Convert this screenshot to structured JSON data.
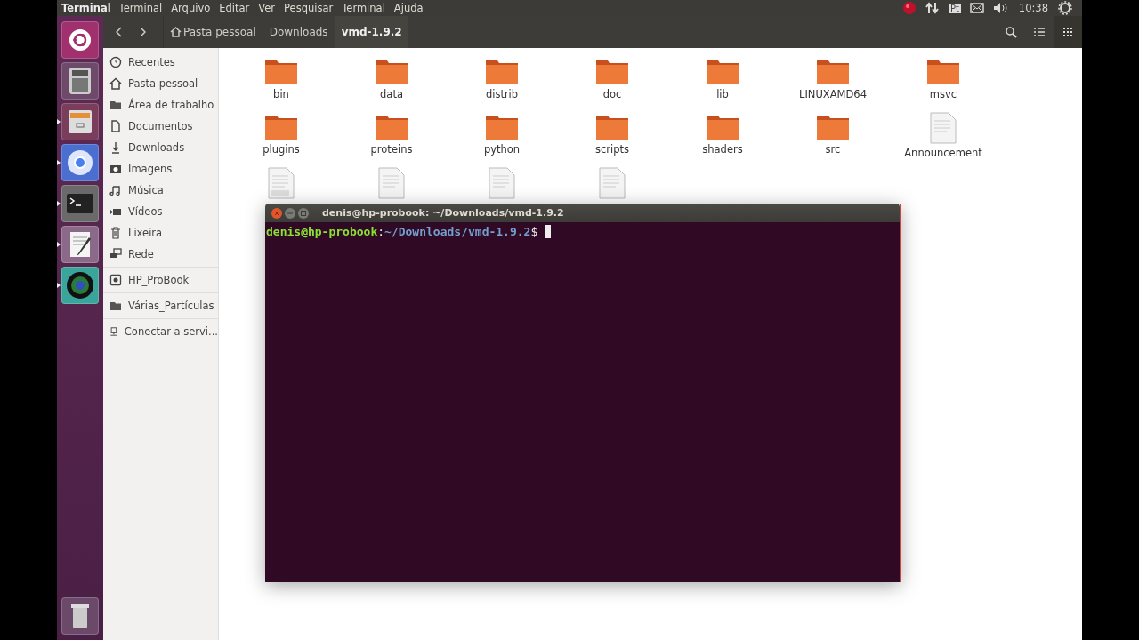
{
  "top_bar": {
    "app_title": "Terminal",
    "menu": [
      "Terminal",
      "Arquivo",
      "Editar",
      "Ver",
      "Pesquisar",
      "Terminal",
      "Ajuda"
    ],
    "keyboard_layout": "Pt",
    "clock": "10:38"
  },
  "launcher": [
    {
      "kind": "ubuntu",
      "running": false
    },
    {
      "kind": "calculator",
      "running": false
    },
    {
      "kind": "files",
      "running": true
    },
    {
      "kind": "browser",
      "running": true
    },
    {
      "kind": "terminal",
      "running": true
    },
    {
      "kind": "editor",
      "running": true
    },
    {
      "kind": "camera",
      "running": true
    },
    {
      "kind": "trash",
      "running": false
    }
  ],
  "breadcrumbs": [
    {
      "label": "Pasta pessoal",
      "home": true,
      "selected": false
    },
    {
      "label": "Downloads",
      "home": false,
      "selected": false
    },
    {
      "label": "vmd-1.9.2",
      "home": false,
      "selected": true
    }
  ],
  "sidebar": {
    "sections": [
      [
        {
          "label": "Recentes",
          "kind": "clock"
        },
        {
          "label": "Pasta pessoal",
          "kind": "home"
        },
        {
          "label": "Área de trabalho",
          "kind": "folder"
        },
        {
          "label": "Documentos",
          "kind": "document"
        },
        {
          "label": "Downloads",
          "kind": "download"
        },
        {
          "label": "Imagens",
          "kind": "camera"
        },
        {
          "label": "Música",
          "kind": "music"
        },
        {
          "label": "Vídeos",
          "kind": "video"
        },
        {
          "label": "Lixeira",
          "kind": "trash"
        },
        {
          "label": "Rede",
          "kind": "network"
        }
      ],
      [
        {
          "label": "HP_ProBook",
          "kind": "drive"
        }
      ],
      [
        {
          "label": "Várias_Partículas",
          "kind": "folder"
        }
      ],
      [
        {
          "label": "Conectar a servi...",
          "kind": "server"
        }
      ]
    ]
  },
  "files": [
    {
      "name": "bin",
      "kind": "folder"
    },
    {
      "name": "data",
      "kind": "folder"
    },
    {
      "name": "distrib",
      "kind": "folder"
    },
    {
      "name": "doc",
      "kind": "folder"
    },
    {
      "name": "lib",
      "kind": "folder"
    },
    {
      "name": "LINUXAMD64",
      "kind": "folder"
    },
    {
      "name": "msvc",
      "kind": "folder"
    },
    {
      "name": "plugins",
      "kind": "folder"
    },
    {
      "name": "proteins",
      "kind": "folder"
    },
    {
      "name": "python",
      "kind": "folder"
    },
    {
      "name": "scripts",
      "kind": "folder"
    },
    {
      "name": "shaders",
      "kind": "folder"
    },
    {
      "name": "src",
      "kind": "folder"
    },
    {
      "name": "Announcement",
      "kind": "text"
    },
    {
      "kind": "perl"
    },
    {
      "kind": "text"
    },
    {
      "kind": "text"
    },
    {
      "kind": "text"
    }
  ],
  "terminal": {
    "title": "denis@hp-probook: ~/Downloads/vmd-1.9.2",
    "prompt": [
      {
        "text": "denis@hp-probook",
        "kind": "user"
      },
      {
        "text": ":",
        "kind": "plain"
      },
      {
        "text": "~/Downloads/vmd-1.9.2",
        "kind": "path"
      },
      {
        "text": "$",
        "kind": "plain"
      }
    ]
  }
}
